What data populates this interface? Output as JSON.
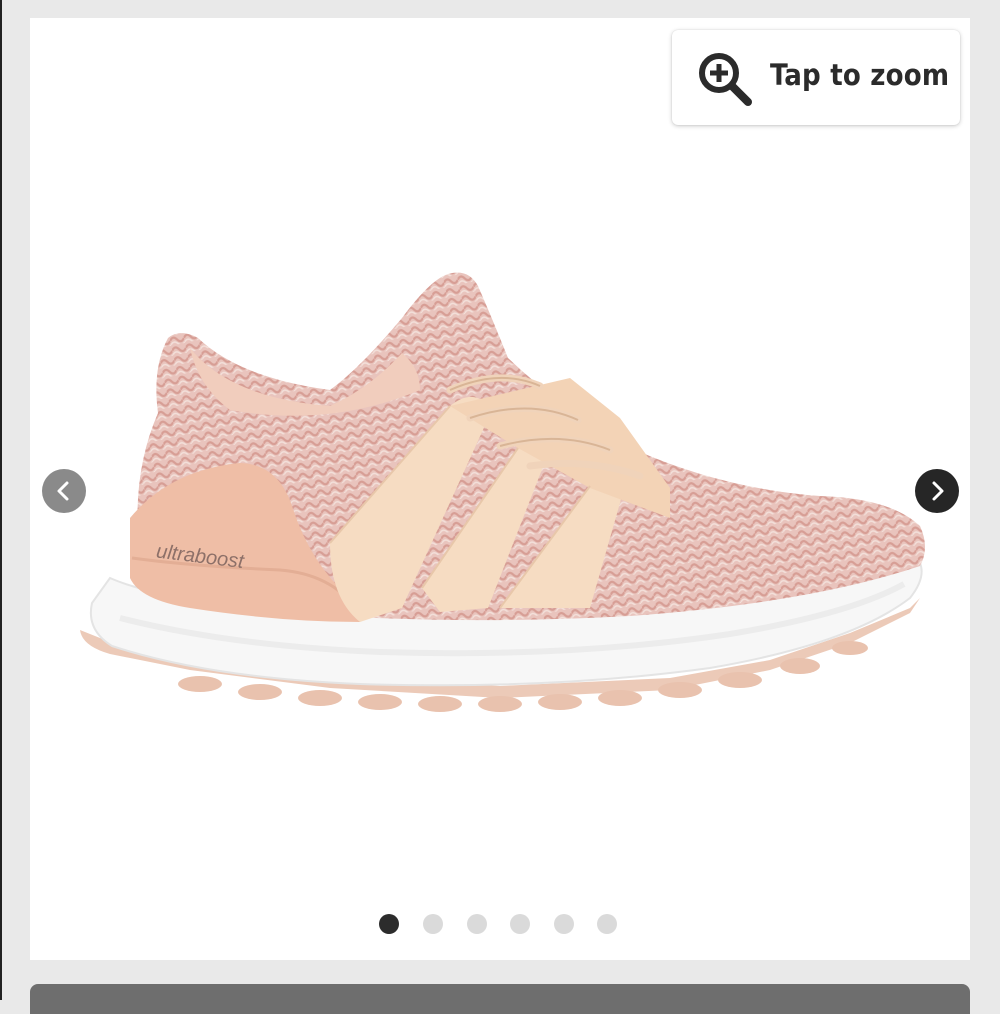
{
  "zoom": {
    "label": "Tap to zoom",
    "icon": "zoom-in-icon"
  },
  "product_image": {
    "brand_text": "ultraboost"
  },
  "carousel": {
    "prev_icon": "chevron-left-icon",
    "next_icon": "chevron-right-icon",
    "dot_count": 6,
    "active_index": 0
  },
  "colors": {
    "page_background": "#e9e9e9",
    "card_background": "#ffffff",
    "active_dot": "#2c2c2c",
    "inactive_dot": "#dadada",
    "next_button": "#262626",
    "prev_button": "#8a8a8a"
  }
}
